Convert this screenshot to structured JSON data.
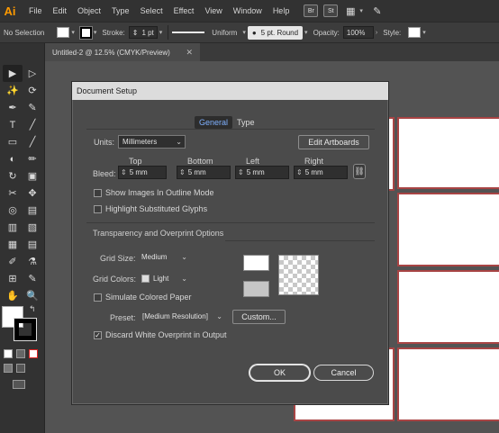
{
  "app": {
    "logo": "Ai"
  },
  "menu": [
    "File",
    "Edit",
    "Object",
    "Type",
    "Select",
    "Effect",
    "View",
    "Window",
    "Help"
  ],
  "menu_icons": [
    {
      "name": "bridge-icon",
      "label": "Br"
    },
    {
      "name": "stock-icon",
      "label": "St"
    },
    {
      "name": "workspace-grid-icon",
      "label": "▦"
    },
    {
      "name": "gpu-performance-icon",
      "label": "✎"
    }
  ],
  "control_bar": {
    "selection": "No Selection",
    "stroke_label": "Stroke:",
    "stroke_value": "1 pt",
    "profile": "Uniform",
    "brush": "5 pt. Round",
    "opacity_label": "Opacity:",
    "opacity_value": "100%",
    "style_label": "Style:"
  },
  "document_tab": {
    "title": "Untitled-2 @ 12.5% (CMYK/Preview)",
    "close": "✕"
  },
  "tools": [
    "▶",
    "▷",
    "✨",
    "⟳",
    "✒",
    "✎",
    "T",
    "╱",
    "▭",
    "╱",
    "◐",
    "✏",
    "↻",
    "▣",
    "✂",
    "✥",
    "◎",
    "▤",
    "▥",
    "▧",
    "▦",
    "▤",
    "✐",
    "⚗",
    "⊞",
    "✎",
    "✋",
    "🔍"
  ],
  "dialog": {
    "title": "Document Setup",
    "tabs": {
      "general": "General",
      "type": "Type"
    },
    "units_label": "Units:",
    "units_value": "Millimeters",
    "edit_artboards": "Edit Artboards",
    "bleed_label": "Bleed:",
    "bleed": {
      "top_label": "Top",
      "top": "5 mm",
      "bottom_label": "Bottom",
      "bottom": "5 mm",
      "left_label": "Left",
      "left": "5 mm",
      "right_label": "Right",
      "right": "5 mm"
    },
    "show_images_outline": "Show Images In Outline Mode",
    "highlight_glyphs": "Highlight Substituted Glyphs",
    "transparency_section": "Transparency and Overprint Options",
    "grid_size_label": "Grid Size:",
    "grid_size_value": "Medium",
    "grid_colors_label": "Grid Colors:",
    "grid_colors_value": "Light",
    "simulate_paper": "Simulate Colored Paper",
    "preset_label": "Preset:",
    "preset_value": "[Medium Resolution]",
    "custom_button": "Custom...",
    "discard_white": "Discard White Overprint in Output",
    "discard_white_checked": true,
    "ok": "OK",
    "cancel": "Cancel"
  }
}
